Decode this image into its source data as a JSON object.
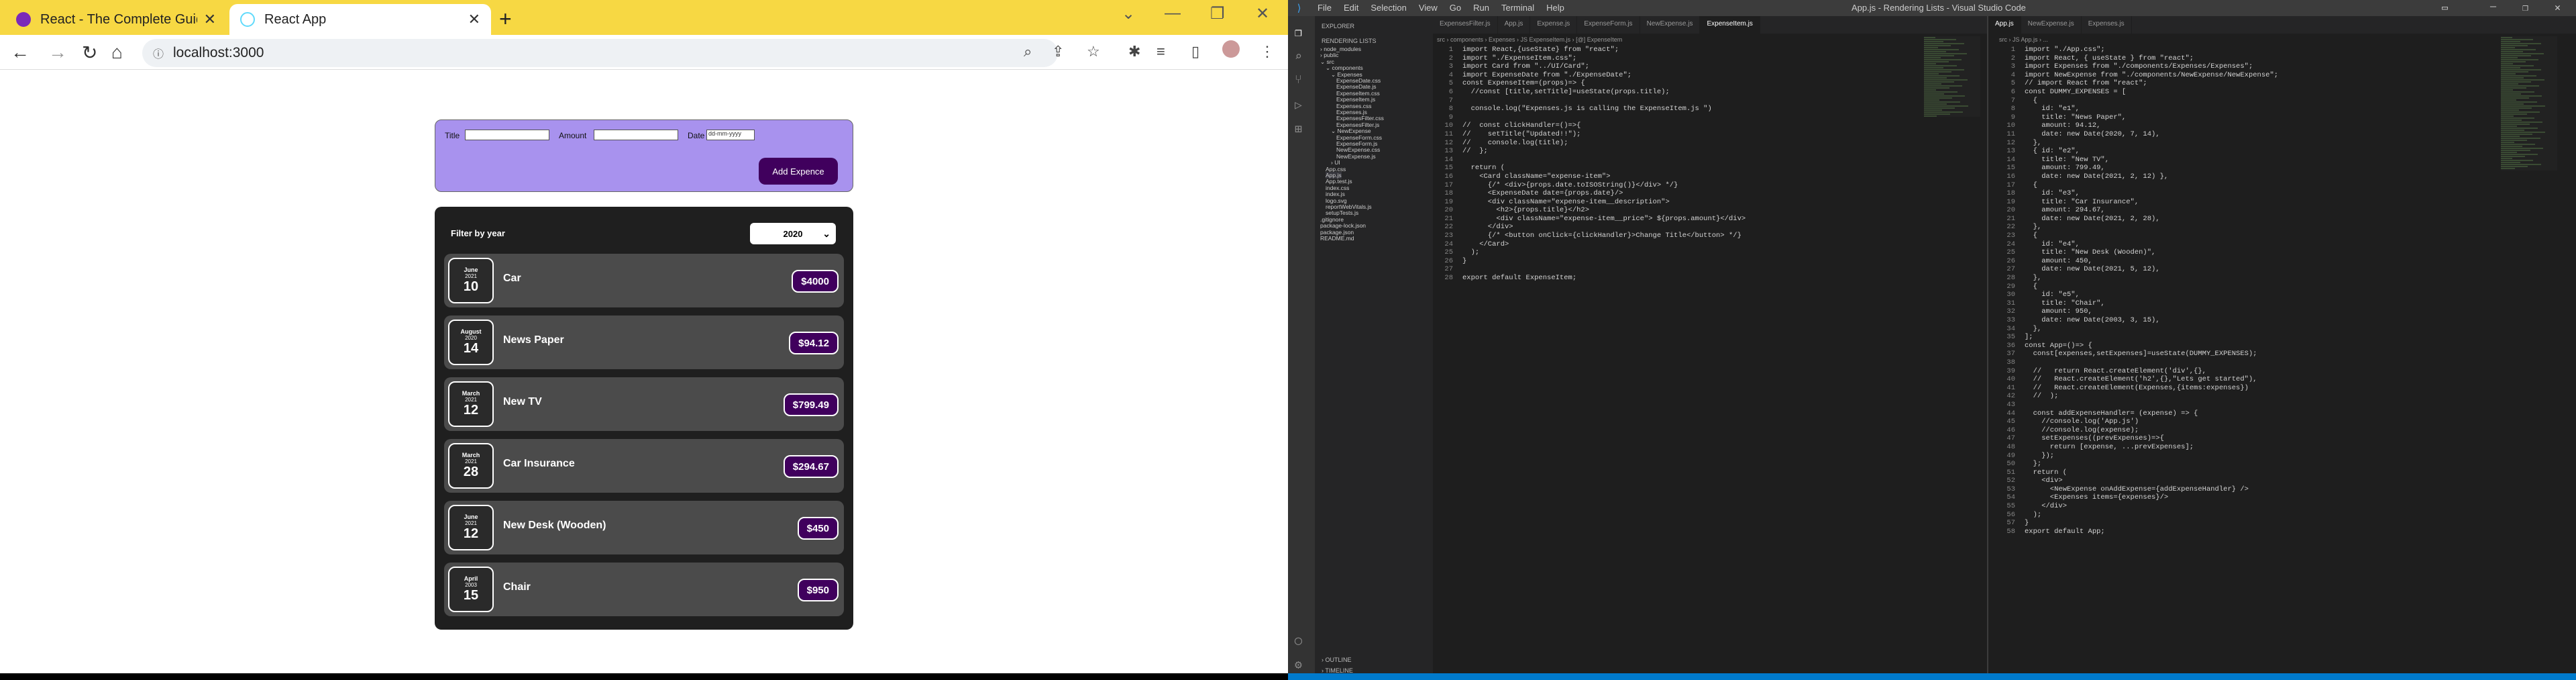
{
  "browser": {
    "tabs": [
      {
        "title": "React - The Complete Guide (inc"
      },
      {
        "title": "React App"
      }
    ],
    "url": "localhost:3000",
    "new_tab": "+",
    "close": "✕"
  },
  "app": {
    "form": {
      "title_label": "Title",
      "amount_label": "Amount",
      "date_label": "Date",
      "date_placeholder": "dd-mm-yyyy",
      "add_button": "Add Expence"
    },
    "filter": {
      "label": "Filter by year",
      "selected_year": "2020"
    },
    "expenses": [
      {
        "month": "June",
        "year": "2021",
        "day": "10",
        "title": "Car",
        "amount": "$4000"
      },
      {
        "month": "August",
        "year": "2020",
        "day": "14",
        "title": "News Paper",
        "amount": "$94.12"
      },
      {
        "month": "March",
        "year": "2021",
        "day": "12",
        "title": "New TV",
        "amount": "$799.49"
      },
      {
        "month": "March",
        "year": "2021",
        "day": "28",
        "title": "Car Insurance",
        "amount": "$294.67"
      },
      {
        "month": "June",
        "year": "2021",
        "day": "12",
        "title": "New Desk (Wooden)",
        "amount": "$450"
      },
      {
        "month": "April",
        "year": "2003",
        "day": "15",
        "title": "Chair",
        "amount": "$950"
      }
    ]
  },
  "vscode": {
    "title": "App.js - Rendering Lists - Visual Studio Code",
    "menu": [
      "File",
      "Edit",
      "Selection",
      "View",
      "Go",
      "Run",
      "Terminal",
      "Help"
    ],
    "explorer": {
      "header": "EXPLORER",
      "project": "RENDERING LISTS",
      "tree": [
        {
          "t": "› node_modules",
          "d": 0
        },
        {
          "t": "› public",
          "d": 0
        },
        {
          "t": "⌄ src",
          "d": 0
        },
        {
          "t": "⌄ components",
          "d": 1
        },
        {
          "t": "⌄ Expenses",
          "d": 2
        },
        {
          "t": "ExpenseDate.css",
          "d": 3
        },
        {
          "t": "ExpenseDate.js",
          "d": 3
        },
        {
          "t": "ExpenseItem.css",
          "d": 3
        },
        {
          "t": "ExpenseItem.js",
          "d": 3
        },
        {
          "t": "Expenses.css",
          "d": 3
        },
        {
          "t": "Expenses.js",
          "d": 3
        },
        {
          "t": "ExpensesFilter.css",
          "d": 3
        },
        {
          "t": "ExpensesFilter.js",
          "d": 3
        },
        {
          "t": "⌄ NewExpense",
          "d": 2
        },
        {
          "t": "ExpenseForm.css",
          "d": 3
        },
        {
          "t": "ExpenseForm.js",
          "d": 3
        },
        {
          "t": "NewExpense.css",
          "d": 3
        },
        {
          "t": "NewExpense.js",
          "d": 3
        },
        {
          "t": "› UI",
          "d": 2
        },
        {
          "t": "App.css",
          "d": 1
        },
        {
          "t": "App.js",
          "d": 1
        },
        {
          "t": "App.test.js",
          "d": 1
        },
        {
          "t": "index.css",
          "d": 1
        },
        {
          "t": "index.js",
          "d": 1
        },
        {
          "t": "logo.svg",
          "d": 1
        },
        {
          "t": "reportWebVitals.js",
          "d": 1
        },
        {
          "t": "setupTests.js",
          "d": 1
        },
        {
          "t": ".gitignore",
          "d": 0
        },
        {
          "t": "package-lock.json",
          "d": 0
        },
        {
          "t": "package.json",
          "d": 0
        },
        {
          "t": "README.md",
          "d": 0
        }
      ],
      "outline": "› OUTLINE",
      "timeline": "› TIMELINE"
    },
    "left_tabs": [
      "ExpensesFilter.js",
      "App.js",
      "Expense.js",
      "ExpenseForm.js",
      "NewExpense.js",
      "ExpenseItem.js"
    ],
    "left_breadcrumb": "src › components › Expenses › JS ExpenseItem.js › [@] ExpenseItem",
    "left_code": "import React,{useState} from \"react\";\nimport \"./ExpenseItem.css\";\nimport Card from \"../UI/Card\";\nimport ExpenseDate from \"./ExpenseDate\";\nconst ExpenseItem=(props)=> {\n  //const [title,setTitle]=useState(props.title);\n\n  console.log(\"Expenses.js is calling the ExpenseItem.js \")\n\n//  const clickHandler=()=>{\n//    setTitle(\"Updated!!\");\n//    console.log(title);\n//  };\n\n  return (\n    <Card className=\"expense-item\">\n      {/* <div>{props.date.toISOString()}</div> */}\n      <ExpenseDate date={props.date}/>\n      <div className=\"expense-item__description\">\n        <h2>{props.title}</h2>\n        <div className=\"expense-item__price\"> ${props.amount}</div>\n      </div>\n      {/* <button onClick={clickHandler}>Change Title</button> */}\n    </Card>\n  );\n}\n\nexport default ExpenseItem;",
    "right_tabs": [
      "App.js",
      "NewExpense.js",
      "Expenses.js"
    ],
    "right_breadcrumb": "src › JS App.js › ...",
    "right_code": "import \"./App.css\";\nimport React, { useState } from \"react\";\nimport Expenses from \"./components/Expenses/Expenses\";\nimport NewExpense from \"./components/NewExpense/NewExpense\";\n// import React from \"react\";\nconst DUMMY_EXPENSES = [\n  {\n    id: \"e1\",\n    title: \"News Paper\",\n    amount: 94.12,\n    date: new Date(2020, 7, 14),\n  },\n  { id: \"e2\",\n    title: \"New TV\",\n    amount: 799.49,\n    date: new Date(2021, 2, 12) },\n  {\n    id: \"e3\",\n    title: \"Car Insurance\",\n    amount: 294.67,\n    date: new Date(2021, 2, 28),\n  },\n  {\n    id: \"e4\",\n    title: \"New Desk (Wooden)\",\n    amount: 450,\n    date: new Date(2021, 5, 12),\n  },\n  {\n    id: \"e5\",\n    title: \"Chair\",\n    amount: 950,\n    date: new Date(2003, 3, 15),\n  },\n];\nconst App=()=> {\n  const[expenses,setExpenses]=useState(DUMMY_EXPENSES);\n\n  //   return React.createElement('div',{},\n  //   React.createElement('h2',{},\"Lets get started\"),\n  //   React.createElement(Expenses,{items:expenses})\n  //  );\n\n  const addExpenseHandler= (expense) => {\n    //console.log('App.js')\n    //console.log(expense);\n    setExpenses((prevExpenses)=>{\n      return [expense, ...prevExpenses];\n    });\n  };\n  return (\n    <div>\n      <NewExpense onAddExpense={addExpenseHandler} />\n      <Expenses items={expenses}/>\n    </div>\n  );\n}\nexport default App;"
  }
}
